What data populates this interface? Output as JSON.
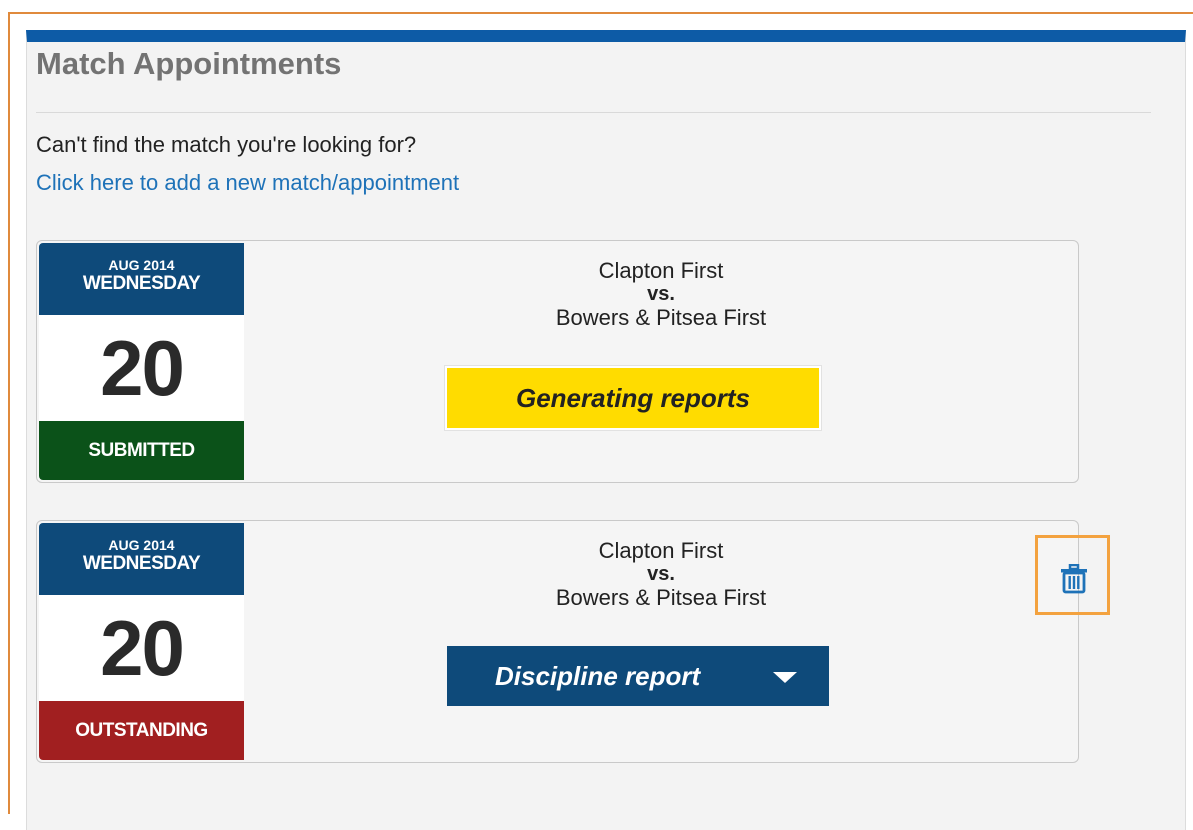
{
  "page": {
    "title": "Match Appointments",
    "prompt": "Can't find the match you're looking for?",
    "add_link": "Click here to add a new match/appointment"
  },
  "appointments": [
    {
      "month": "AUG 2014",
      "weekday": "WEDNESDAY",
      "day": "20",
      "status": "SUBMITTED",
      "home_team": "Clapton First",
      "vs": "vs.",
      "away_team": "Bowers & Pitsea First",
      "action_label": "Generating reports"
    },
    {
      "month": "AUG 2014",
      "weekday": "WEDNESDAY",
      "day": "20",
      "status": "OUTSTANDING",
      "home_team": "Clapton First",
      "vs": "vs.",
      "away_team": "Bowers & Pitsea First",
      "action_label": "Discipline report",
      "action_icon": "chevron-down-icon",
      "delete_icon": "trash-icon"
    }
  ],
  "colors": {
    "accent": "#0d5ba6",
    "calendar_header": "#0e4a7a",
    "status_submitted": "#0b5219",
    "status_outstanding": "#a11f20",
    "generating_button": "#ffdc00",
    "highlight": "#f3a23f",
    "link": "#1e72b8"
  }
}
